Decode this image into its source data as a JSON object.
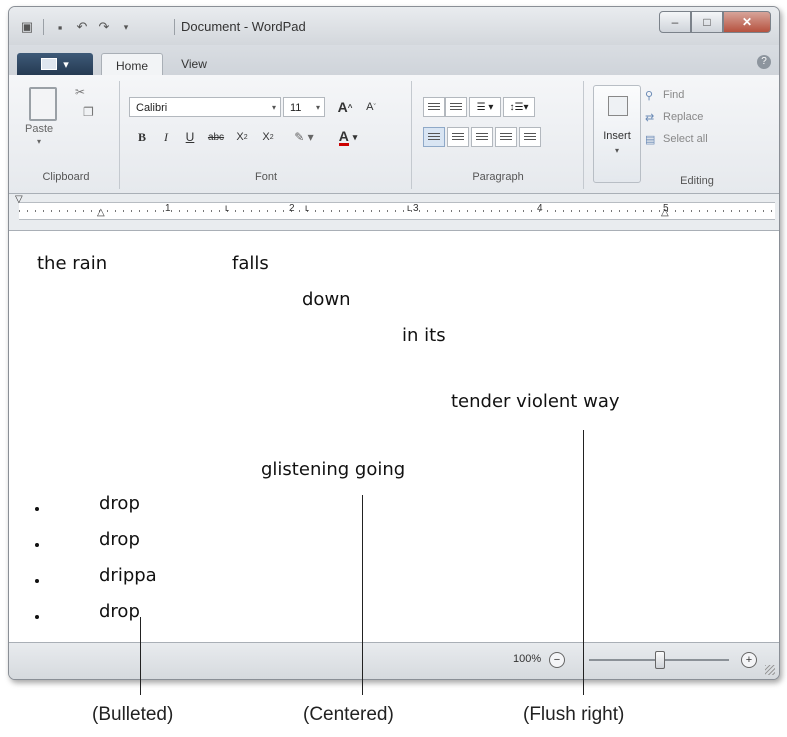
{
  "window": {
    "title": "Document - WordPad"
  },
  "title_bar": {
    "quick_access_icons": [
      "wordpad-icon",
      "save-icon",
      "undo-icon",
      "redo-icon",
      "customize-icon"
    ],
    "window_buttons": [
      "minimize-icon",
      "maximize-icon",
      "close-icon"
    ]
  },
  "tabs": [
    {
      "label": "Home",
      "active": true
    },
    {
      "label": "View",
      "active": false
    }
  ],
  "ribbon": {
    "clipboard": {
      "paste_label": "Paste",
      "group_label": "Clipboard"
    },
    "font": {
      "font_name": "Calibri",
      "font_size": "11",
      "group_label": "Font"
    },
    "paragraph": {
      "group_label": "Paragraph"
    },
    "insert": {
      "label": "Insert"
    },
    "editing": {
      "find_label": "Find",
      "replace_label": "Replace",
      "select_all_label": "Select all",
      "group_label": "Editing"
    }
  },
  "ruler": {
    "numbers": [
      "1",
      "2",
      "3",
      "4",
      "5"
    ]
  },
  "document": {
    "lines": [
      "the rain",
      "falls",
      "down",
      "in its",
      "tender violent way",
      "glistening going"
    ],
    "bullets": [
      "drop",
      "drop",
      "drippa",
      "drop"
    ]
  },
  "status_bar": {
    "zoom": "100%",
    "zoom_out_symbol": "−",
    "zoom_in_symbol": "+"
  },
  "callouts": {
    "bulleted": "(Bulleted)",
    "centered": "(Centered)",
    "flush_right": "(Flush right)"
  },
  "colors": {
    "app_button": "#2f4a66",
    "window_close": "#c0523f"
  }
}
